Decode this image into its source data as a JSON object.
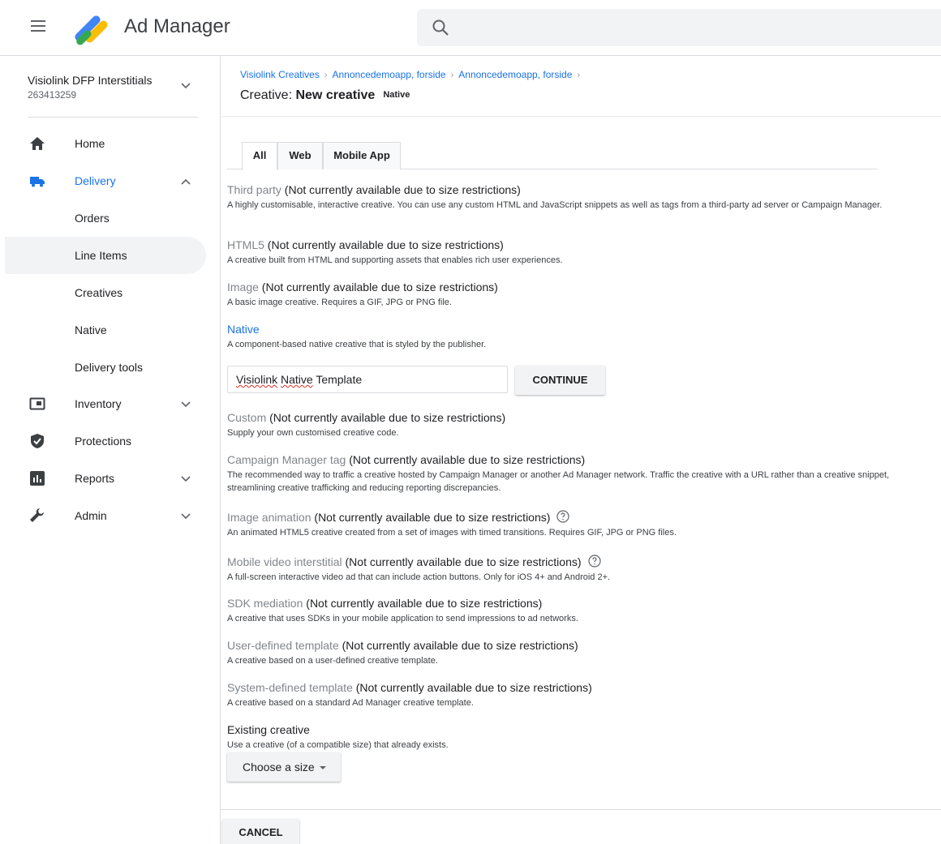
{
  "app": {
    "title": "Ad Manager"
  },
  "network": {
    "name": "Visiolink DFP Interstitials",
    "id": "263413259"
  },
  "nav": {
    "home": "Home",
    "delivery": "Delivery",
    "orders": "Orders",
    "line_items": "Line Items",
    "creatives": "Creatives",
    "native": "Native",
    "delivery_tools": "Delivery tools",
    "inventory": "Inventory",
    "protections": "Protections",
    "reports": "Reports",
    "admin": "Admin"
  },
  "breadcrumb": [
    "Visiolink Creatives",
    "Annoncedemoapp, forside",
    "Annoncedemoapp, forside"
  ],
  "page_title": {
    "prefix": "Creative: ",
    "name": "New creative",
    "badge": "Native"
  },
  "tabs": [
    "All",
    "Web",
    "Mobile App"
  ],
  "options": [
    {
      "name": "Third party",
      "status": " (Not currently available due to size restrictions)",
      "desc": "A highly customisable, interactive creative. You can use any custom HTML and JavaScript snippets as well as tags from a third-party ad server or Campaign Manager."
    },
    {
      "name": "HTML5",
      "status": " (Not currently available due to size restrictions)",
      "desc": "A creative built from HTML and supporting assets that enables rich user experiences."
    },
    {
      "name": "Image",
      "status": " (Not currently available due to size restrictions)",
      "desc": "A basic image creative. Requires a GIF, JPG or PNG file."
    },
    {
      "name": "Native",
      "status": "",
      "desc": "A component-based native creative that is styled by the publisher."
    },
    {
      "name": "Custom",
      "status": " (Not currently available due to size restrictions)",
      "desc": "Supply your own customised creative code."
    },
    {
      "name": "Campaign Manager tag",
      "status": " (Not currently available due to size restrictions)",
      "desc": "The recommended way to traffic a creative hosted by Campaign Manager or another Ad Manager network. Traffic the creative with a URL rather than a creative snippet, streamlining creative trafficking and reducing reporting discrepancies."
    },
    {
      "name": "Image animation",
      "status": " (Not currently available due to size restrictions)",
      "desc": "An animated HTML5 creative created from a set of images with timed transitions. Requires GIF, JPG or PNG files."
    },
    {
      "name": "Mobile video interstitial",
      "status": " (Not currently available due to size restrictions)",
      "desc": "A full-screen interactive video ad that can include action buttons. Only for iOS 4+ and Android 2+."
    },
    {
      "name": "SDK mediation",
      "status": " (Not currently available due to size restrictions)",
      "desc": "A creative that uses SDKs in your mobile application to send impressions to ad networks."
    },
    {
      "name": "User-defined template",
      "status": " (Not currently available due to size restrictions)",
      "desc": "A creative based on a user-defined creative template."
    },
    {
      "name": "System-defined template",
      "status": " (Not currently available due to size restrictions)",
      "desc": "A creative based on a standard Ad Manager creative template."
    },
    {
      "name": "Existing creative",
      "status": "",
      "desc": "Use a creative (of a compatible size) that already exists."
    }
  ],
  "native_template": {
    "word1": "Visiolink",
    "word2": "Native",
    "rest": " Template"
  },
  "buttons": {
    "continue": "CONTINUE",
    "choose_size": "Choose a size",
    "cancel": "CANCEL"
  },
  "icons": {
    "menu": "hamburger-icon",
    "search": "search-icon",
    "home": "home-icon",
    "delivery": "truck-icon",
    "inventory": "inventory-icon",
    "protections": "shield-icon",
    "reports": "bar-chart-icon",
    "admin": "wrench-icon",
    "help": "help-circle-icon"
  },
  "colors": {
    "accent": "#1a73e8",
    "logo_blue": "#4285f4",
    "logo_yellow": "#fbbc04",
    "logo_green": "#34a853",
    "unavailable": "#80868b"
  }
}
